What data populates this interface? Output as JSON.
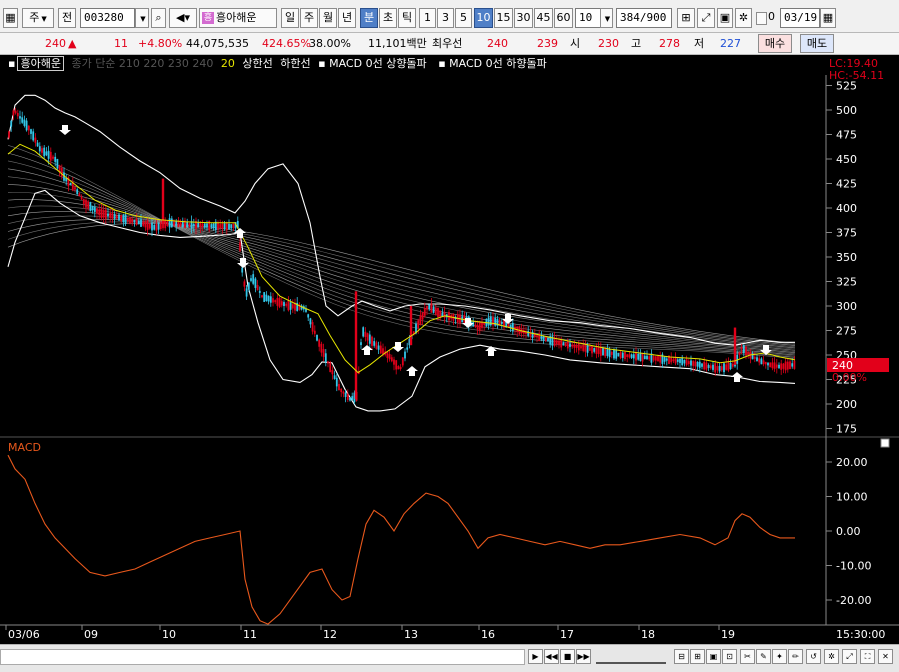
{
  "toolbar": {
    "period_select": "주",
    "prev_btn": "전",
    "stock_code": "003280",
    "stock_name": "흥아해운",
    "stock_badge": "흥",
    "period_tabs": [
      "일",
      "주",
      "월",
      "년",
      "분",
      "초",
      "틱"
    ],
    "selected_period": "분",
    "minute_tabs": [
      "1",
      "3",
      "5",
      "10",
      "15",
      "30",
      "45",
      "60"
    ],
    "selected_minute": "10",
    "minute_dropdown": "10",
    "count_value": "384",
    "count_total": "/900",
    "date_value": "03/19",
    "date_checkbox_label": "0"
  },
  "quote": {
    "price": "240",
    "change_arrow": "▲",
    "change": "11",
    "change_pct": "+4.80%",
    "volume": "44,075,535",
    "volume_ratio": "424.65%",
    "rate": "38.00%",
    "amount": "11,101백만",
    "best_label": "최우선",
    "best_ask": "240",
    "best_bid": "239",
    "open_label": "시",
    "open": "230",
    "high_label": "고",
    "high": "278",
    "low_label": "저",
    "low": "227",
    "buy_btn": "매수",
    "sell_btn": "매도"
  },
  "legend": {
    "name": "흥아해운",
    "ma_text": "종가 단순 210  220  230  240",
    "ma_20": "20",
    "upper": "상한선",
    "lower": "하한선",
    "macd_up": "MACD 0선 상향돌파",
    "macd_down": "MACD 0선 하향돌파"
  },
  "price_panel": {
    "lc": "LC:19.40",
    "hc": "HC:-54.11",
    "yticks": [
      "525",
      "500",
      "475",
      "450",
      "425",
      "400",
      "375",
      "350",
      "325",
      "300",
      "275",
      "250",
      "225",
      "200",
      "175"
    ],
    "current_price": "240",
    "current_pct": "0.00%"
  },
  "macd_panel": {
    "title": "MACD",
    "yticks": [
      "20.00",
      "10.00",
      "0.00",
      "-10.00",
      "-20.00"
    ]
  },
  "x_axis": {
    "labels": [
      "03/06",
      "09",
      "10",
      "11",
      "12",
      "13",
      "16",
      "17",
      "18",
      "19"
    ],
    "time": "15:30:00"
  },
  "colors": {
    "up": "#e2001a",
    "down": "#33c6e8",
    "macd": "#e8581c",
    "ma20": "#e6e600",
    "band": "#ffffff",
    "grid": "#3a3a3a"
  }
}
